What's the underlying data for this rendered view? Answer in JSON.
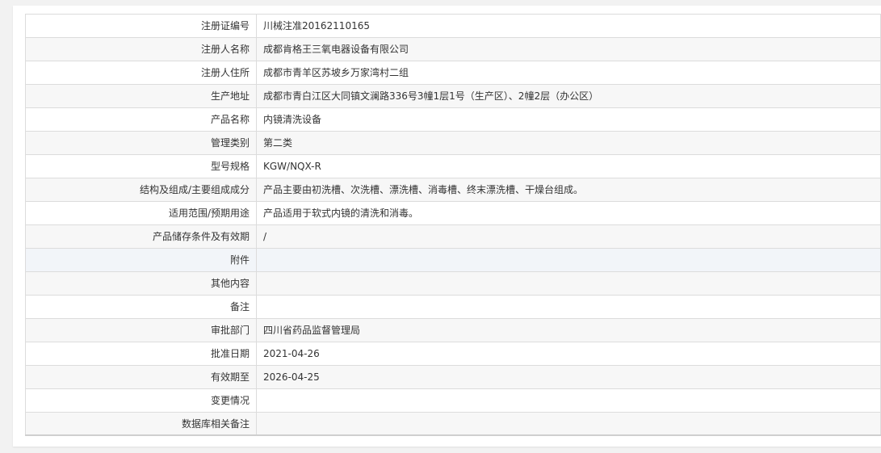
{
  "rows": [
    {
      "label": "注册证编号",
      "value": "川械注准20162110165"
    },
    {
      "label": "注册人名称",
      "value": "成都肯格王三氧电器设备有限公司"
    },
    {
      "label": "注册人住所",
      "value": "成都市青羊区苏坡乡万家湾村二组"
    },
    {
      "label": "生产地址",
      "value": "成都市青白江区大同镇文澜路336号3幢1层1号（生产区）、2幢2层（办公区）"
    },
    {
      "label": "产品名称",
      "value": "内镜清洗设备"
    },
    {
      "label": "管理类别",
      "value": "第二类"
    },
    {
      "label": "型号规格",
      "value": "KGW/NQX-R"
    },
    {
      "label": "结构及组成/主要组成成分",
      "value": "产品主要由初洗槽、次洗槽、漂洗槽、消毒槽、终末漂洗槽、干燥台组成。"
    },
    {
      "label": "适用范围/预期用途",
      "value": "产品适用于软式内镜的清洗和消毒。"
    },
    {
      "label": "产品储存条件及有效期",
      "value": "/"
    },
    {
      "label": "附件",
      "value": ""
    },
    {
      "label": "其他内容",
      "value": ""
    },
    {
      "label": "备注",
      "value": ""
    },
    {
      "label": "审批部门",
      "value": "四川省药品监督管理局"
    },
    {
      "label": "批准日期",
      "value": "2021-04-26"
    },
    {
      "label": "有效期至",
      "value": "2026-04-25"
    },
    {
      "label": "变更情况",
      "value": ""
    },
    {
      "label": "数据库相关备注",
      "value": ""
    }
  ]
}
